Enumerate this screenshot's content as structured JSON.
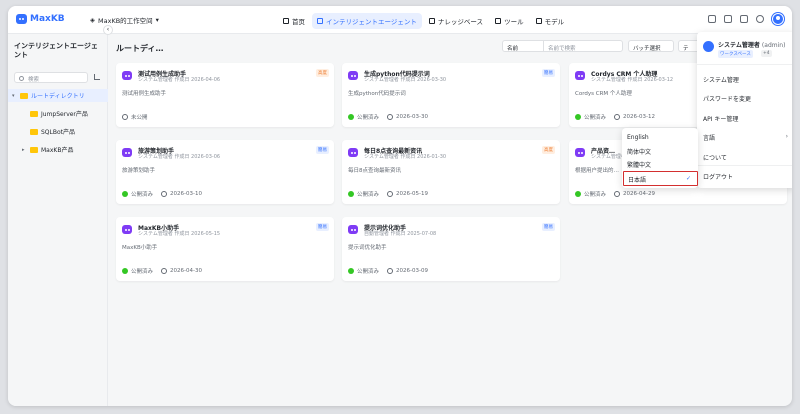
{
  "app": {
    "logo_text": "MaxKB",
    "workspace": "MaxKB的工作空间"
  },
  "nav": [
    {
      "label": "首页",
      "icon": "home-icon"
    },
    {
      "label": "インテリジェントエージェント",
      "icon": "agent-icon"
    },
    {
      "label": "ナレッジベース",
      "icon": "book-icon"
    },
    {
      "label": "ツール",
      "icon": "toolbox-icon"
    },
    {
      "label": "モデル",
      "icon": "model-icon"
    }
  ],
  "sidebar": {
    "title": "インテリジェントエージェント",
    "search_placeholder": "検索",
    "items": [
      {
        "label": "ルートディレクトリ"
      },
      {
        "label": "JumpServer产品"
      },
      {
        "label": "SQLBot产品"
      },
      {
        "label": "MaxKB产品"
      }
    ]
  },
  "main": {
    "title": "ルートディ…",
    "filter_select": "名前",
    "filter_placeholder": "名前で検索",
    "batch_label": "バッチ選択",
    "more_label": "テ"
  },
  "cards": [
    {
      "name": "测试用例生成助手",
      "meta": "システム管理者 作成日 2026-04-06",
      "desc": "测试用例生成助手",
      "tag": "高度",
      "status": "未公開",
      "date": ""
    },
    {
      "name": "生成python代码提示词",
      "meta": "システム管理者 作成日 2026-03-30",
      "desc": "生成python代码提示词",
      "tag": "簡易",
      "status": "公開済み",
      "date": "2026-03-30"
    },
    {
      "name": "Cordys CRM 个人助理",
      "meta": "システム管理者 作成日 2026-03-12",
      "desc": "Cordys CRM 个人助理",
      "tag": "",
      "status": "公開済み",
      "date": "2026-03-12"
    },
    {
      "name": "旅游策划助手",
      "meta": "システム管理者 作成日 2026-03-06",
      "desc": "旅游策划助手",
      "tag": "簡易",
      "status": "公開済み",
      "date": "2026-03-10"
    },
    {
      "name": "每日8点查询最新资讯",
      "meta": "システム管理者 作成日 2026-01-30",
      "desc": "每日8点查询最新资讯",
      "tag": "高度",
      "status": "公開済み",
      "date": "2026-05-19"
    },
    {
      "name": "产品资…",
      "meta": "システム管理者",
      "desc": "根据用户提出的…",
      "tag": "",
      "status": "公開済み",
      "date": "2026-04-29"
    },
    {
      "name": "MaxKB小助手",
      "meta": "システム管理者 作成日 2026-05-15",
      "desc": "MaxKB小助手",
      "tag": "簡易",
      "status": "公開済み",
      "date": "2026-04-30"
    },
    {
      "name": "提示词优化助手",
      "meta": "自動管理者 作成日 2025-07-08",
      "desc": "提示词优化助手",
      "tag": "簡易",
      "status": "公開済み",
      "date": "2026-03-09"
    }
  ],
  "user_menu": {
    "name": "システム管理者",
    "role": "(admin)",
    "badge": "ワークスペース",
    "badge2": "+4",
    "items": [
      "システム管理",
      "パスワードを変更",
      "API キー管理",
      "言語",
      "について",
      "ログアウト"
    ]
  },
  "lang_menu": {
    "items": [
      "English",
      "简体中文",
      "繁體中文"
    ],
    "selected": "日本語"
  },
  "colors": {
    "accent": "#3370ff",
    "highlight_border": "#d32f2f"
  }
}
